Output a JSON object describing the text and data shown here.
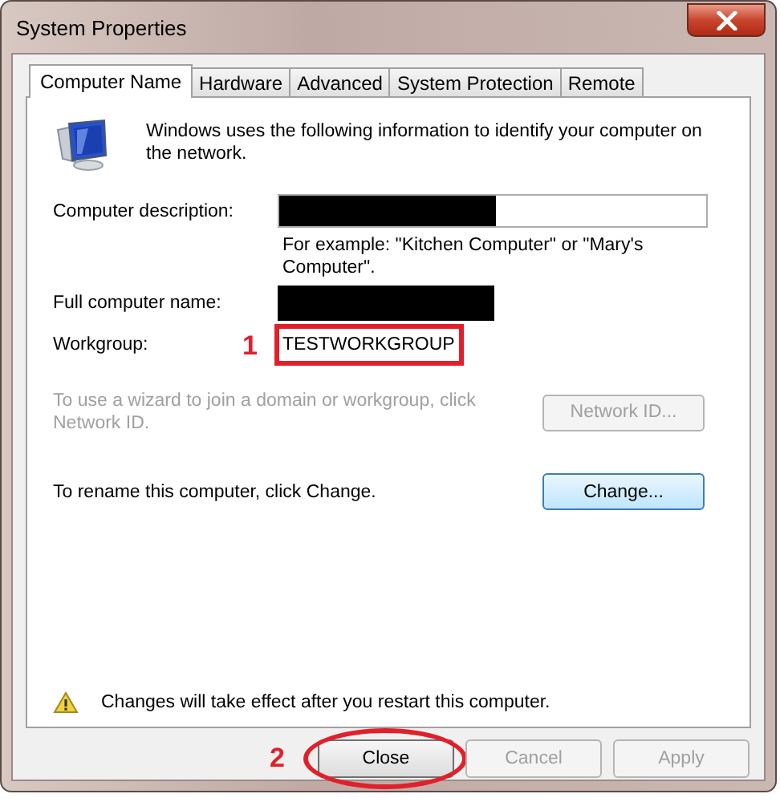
{
  "window": {
    "title": "System Properties"
  },
  "tabs": [
    {
      "label": "Computer Name",
      "selected": true
    },
    {
      "label": "Hardware",
      "selected": false
    },
    {
      "label": "Advanced",
      "selected": false
    },
    {
      "label": "System Protection",
      "selected": false
    },
    {
      "label": "Remote",
      "selected": false
    }
  ],
  "intro": "Windows uses the following information to identify your computer on the network.",
  "description": {
    "label": "Computer description:",
    "redacted": true,
    "hint": "For example: \"Kitchen Computer\" or \"Mary's Computer\"."
  },
  "full_name": {
    "label": "Full computer name:",
    "redacted": true
  },
  "workgroup": {
    "label": "Workgroup:",
    "value": "TESTWORKGROUP",
    "annotation": {
      "number": "1",
      "kind": "box"
    }
  },
  "actions": [
    {
      "text": "To use a wizard to join a domain or workgroup, click Network ID.",
      "button": "Network ID...",
      "disabled": true
    },
    {
      "text": "To rename this computer, click Change.",
      "button": "Change...",
      "disabled": false
    }
  ],
  "notice": "Changes will take effect after you restart this computer.",
  "buttons": [
    {
      "label": "Close",
      "disabled": false,
      "annotation": {
        "number": "2",
        "kind": "ellipse"
      }
    },
    {
      "label": "Cancel",
      "disabled": true
    },
    {
      "label": "Apply",
      "disabled": true
    }
  ]
}
